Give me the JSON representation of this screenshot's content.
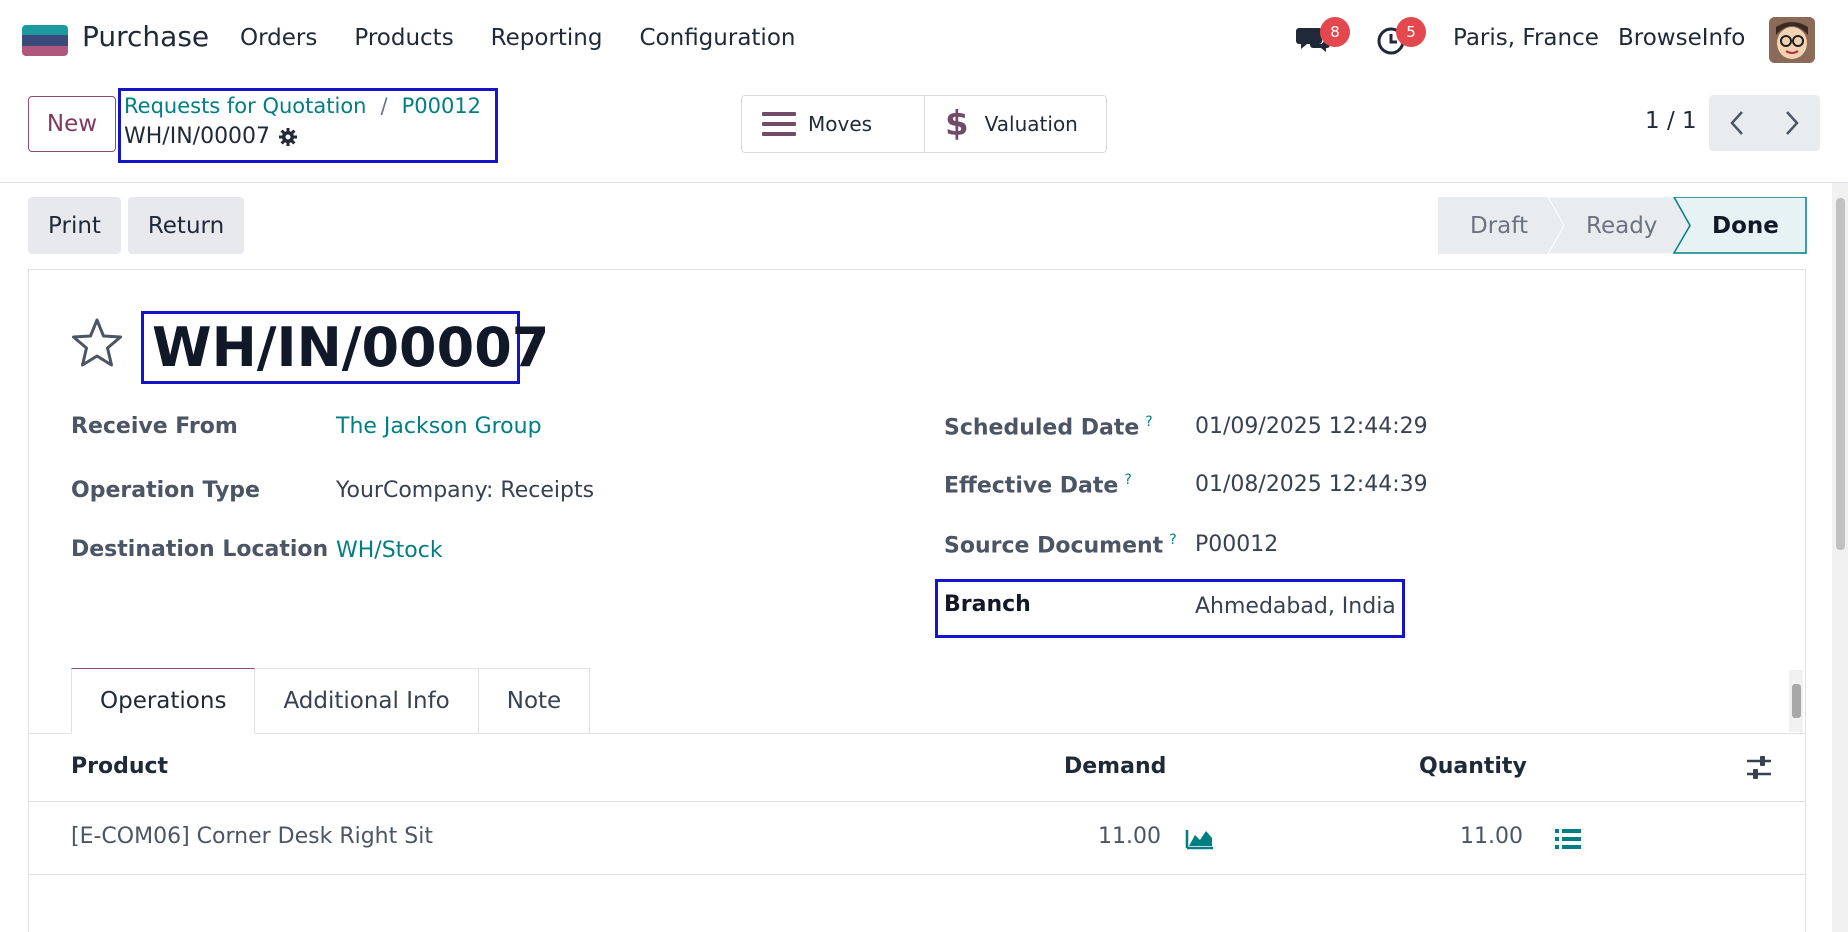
{
  "navbar": {
    "app_name": "Purchase",
    "menu": [
      "Orders",
      "Products",
      "Reporting",
      "Configuration"
    ],
    "messages_count": "8",
    "activities_count": "5",
    "company": "Paris, France",
    "user": "BrowseInfo"
  },
  "control_panel": {
    "new_label": "New",
    "breadcrumb": [
      "Requests for Quotation",
      "P00012"
    ],
    "current_record": "WH/IN/00007",
    "smart_buttons": [
      "Moves",
      "Valuation"
    ],
    "pager": "1 / 1"
  },
  "actions": {
    "print_label": "Print",
    "return_label": "Return"
  },
  "statusbar": [
    "Draft",
    "Ready",
    "Done"
  ],
  "statusbar_active": "Done",
  "form": {
    "title": "WH/IN/00007",
    "left_fields": [
      {
        "label": "Receive From",
        "value": "The Jackson Group"
      },
      {
        "label": "Operation Type",
        "value": "YourCompany: Receipts"
      },
      {
        "label": "Destination Location",
        "value": "WH/Stock"
      }
    ],
    "right_fields": [
      {
        "label": "Scheduled Date",
        "value": "01/09/2025 12:44:29"
      },
      {
        "label": "Effective Date",
        "value": "01/08/2025 12:44:39"
      },
      {
        "label": "Source Document",
        "value": "P00012"
      },
      {
        "label": "Branch",
        "value": "Ahmedabad, India"
      }
    ],
    "help_mark": "?"
  },
  "tabs": [
    "Operations",
    "Additional Info",
    "Note"
  ],
  "table": {
    "headers": [
      "Product",
      "Demand",
      "Quantity"
    ],
    "rows": [
      {
        "product": "[E-COM06] Corner Desk Right Sit",
        "demand": "11.00",
        "quantity": "11.00"
      }
    ]
  },
  "colors": {
    "accent": "#017e84",
    "brand": "#714b67",
    "highlight_box": "#1414c8"
  }
}
